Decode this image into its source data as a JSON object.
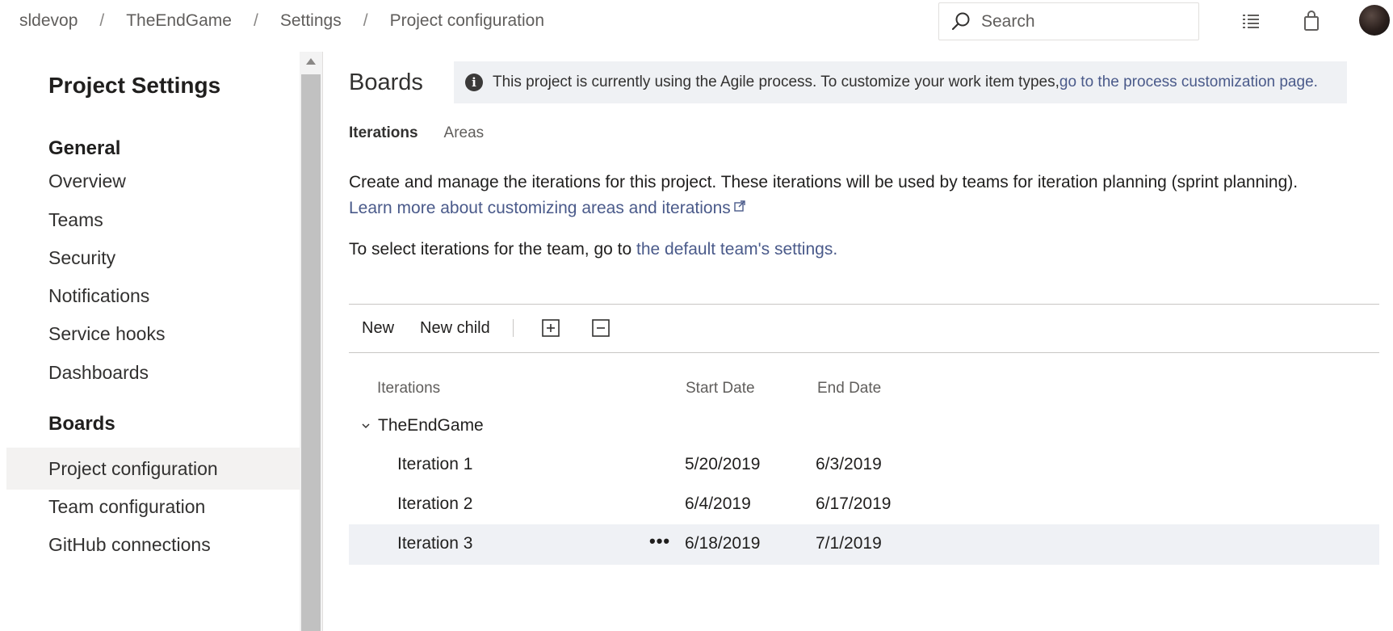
{
  "breadcrumb": [
    "sldevop",
    "TheEndGame",
    "Settings",
    "Project configuration"
  ],
  "search": {
    "placeholder": "Search"
  },
  "sidebar": {
    "title": "Project Settings",
    "sections": [
      {
        "label": "General",
        "items": [
          "Overview",
          "Teams",
          "Security",
          "Notifications",
          "Service hooks",
          "Dashboards"
        ]
      },
      {
        "label": "Boards",
        "items": [
          "Project configuration",
          "Team configuration",
          "GitHub connections"
        ]
      }
    ],
    "selected": "Project configuration"
  },
  "main": {
    "title": "Boards",
    "info": {
      "text": "This project is currently using the Agile process. To customize your work item types, ",
      "link": "go to the process customization page."
    },
    "tabs": [
      "Iterations",
      "Areas"
    ],
    "active_tab": "Iterations",
    "description": "Create and manage the iterations for this project. These iterations will be used by teams for iteration planning (sprint planning). ",
    "description_link": "Learn more about customizing areas and iterations",
    "team_text": "To select iterations for the team, go to ",
    "team_link": "the default team's settings."
  },
  "toolbar": {
    "new_label": "New",
    "new_child_label": "New child"
  },
  "table": {
    "columns": [
      "Iterations",
      "Start Date",
      "End Date"
    ],
    "root": "TheEndGame",
    "rows": [
      {
        "name": "Iteration 1",
        "start": "5/20/2019",
        "end": "6/3/2019"
      },
      {
        "name": "Iteration 2",
        "start": "6/4/2019",
        "end": "6/17/2019"
      },
      {
        "name": "Iteration 3",
        "start": "6/18/2019",
        "end": "7/1/2019"
      }
    ],
    "more_label": "•••"
  }
}
